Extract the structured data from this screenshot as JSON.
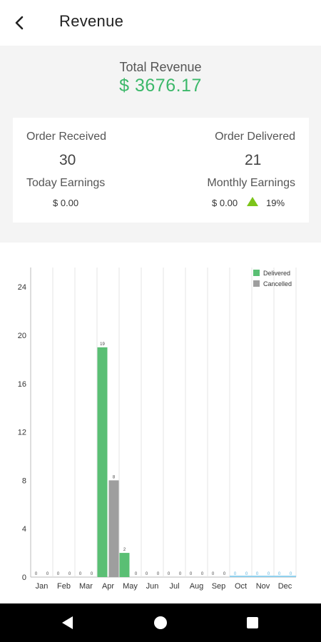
{
  "header": {
    "title": "Revenue",
    "back_icon": "chevron-left-icon"
  },
  "summary": {
    "total_label": "Total Revenue",
    "total_value": "$ 3676.17"
  },
  "stats": {
    "order_received_label": "Order Received",
    "order_received_value": "30",
    "order_delivered_label": "Order Delivered",
    "order_delivered_value": "21",
    "today_earnings_label": "Today Earnings",
    "today_earnings_value": "$ 0.00",
    "monthly_earnings_label": "Monthly Earnings",
    "monthly_earnings_value": "$ 0.00",
    "monthly_change": "19%",
    "trend_icon": "triangle-up-icon",
    "trend_color": "#7cc41a"
  },
  "chart_data": {
    "type": "bar",
    "categories": [
      "Jan",
      "Feb",
      "Mar",
      "Apr",
      "May",
      "Jun",
      "Jul",
      "Aug",
      "Sep",
      "Oct",
      "Nov",
      "Dec"
    ],
    "series": [
      {
        "name": "Delivered",
        "color": "#5abf74",
        "values": [
          0,
          0,
          0,
          19,
          2,
          0,
          0,
          0,
          0,
          0,
          0,
          0
        ]
      },
      {
        "name": "Cancelled",
        "color": "#9e9e9e",
        "values": [
          0,
          0,
          0,
          8,
          0,
          0,
          0,
          0,
          0,
          0,
          0,
          0
        ]
      }
    ],
    "yticks": [
      "0",
      "4",
      "8",
      "12",
      "16",
      "20",
      "24"
    ],
    "ylim": [
      0,
      25.6
    ],
    "grid": true,
    "legend": "top-right",
    "show_value_labels": true
  },
  "navbar": {
    "back_icon": "triangle-back-icon",
    "home_icon": "circle-home-icon",
    "recents_icon": "square-recents-icon"
  }
}
